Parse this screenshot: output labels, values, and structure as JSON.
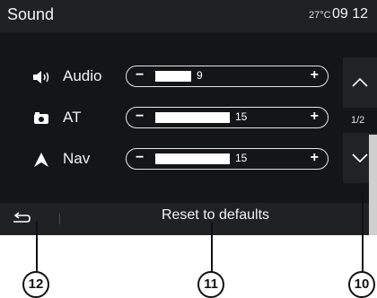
{
  "header": {
    "title": "Sound",
    "temperature": "27°C",
    "time": "09 12"
  },
  "rows": [
    {
      "label": "Audio",
      "value": "9",
      "level": 0.25,
      "icon": "speaker-icon"
    },
    {
      "label": "AT",
      "value": "15",
      "level": 0.52,
      "icon": "phone-icon"
    },
    {
      "label": "Nav",
      "value": "15",
      "level": 0.52,
      "icon": "navigation-arrow-icon"
    }
  ],
  "pager": {
    "indicator": "1/2"
  },
  "footer": {
    "reset_label": "Reset to defaults"
  },
  "callouts": {
    "c12": "12",
    "c11": "11",
    "c10": "10"
  }
}
